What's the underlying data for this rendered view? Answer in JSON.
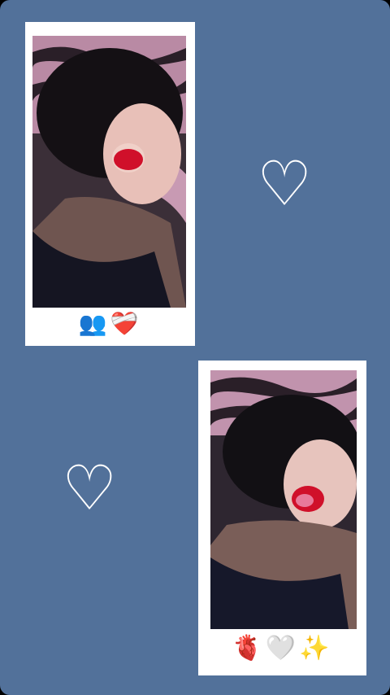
{
  "polaroid_top": {
    "emoji": "👥❤️‍🩹"
  },
  "polaroid_bottom": {
    "emoji": "🫀🤍✨"
  },
  "heart_right": {
    "glyph": "♡"
  },
  "heart_left": {
    "glyph": "♡"
  },
  "colors": {
    "background": "#52719a",
    "frame": "#ffffff",
    "lips": "#d0102a"
  }
}
